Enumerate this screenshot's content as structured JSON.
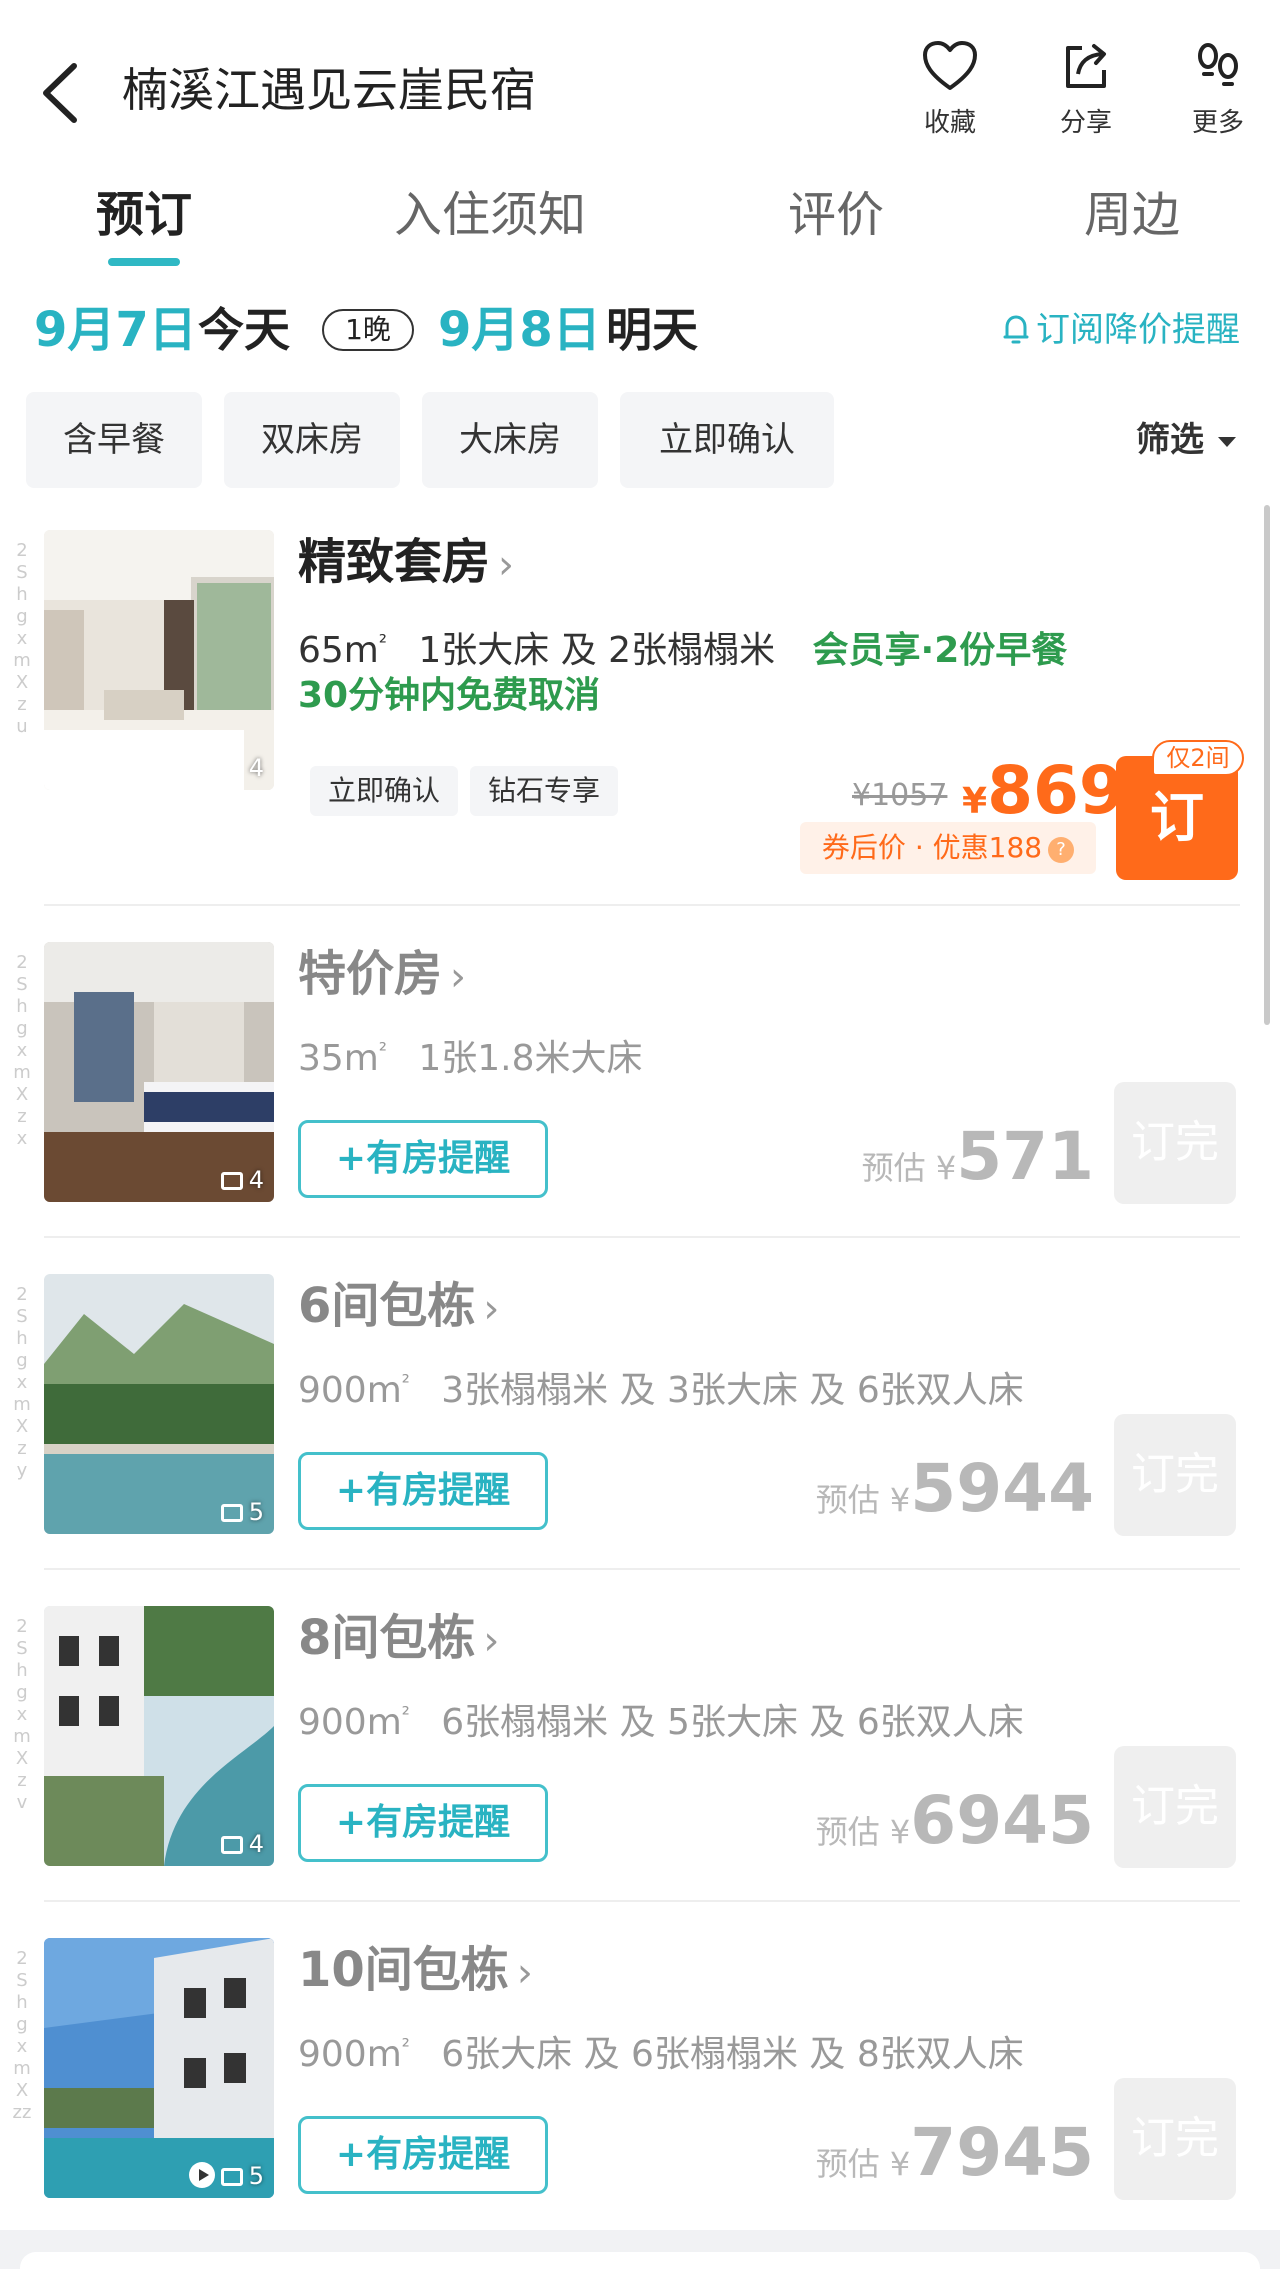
{
  "header": {
    "title": "楠溪江遇见云崖民宿",
    "actions": [
      {
        "label": "收藏",
        "icon": "heart-icon"
      },
      {
        "label": "分享",
        "icon": "share-icon"
      },
      {
        "label": "更多",
        "icon": "footprints-icon"
      }
    ]
  },
  "tabs": [
    {
      "label": "预订",
      "active": true
    },
    {
      "label": "入住须知",
      "active": false
    },
    {
      "label": "评价",
      "active": false
    },
    {
      "label": "周边",
      "active": false
    }
  ],
  "dates": {
    "checkin": "9月7日",
    "checkin_word": "今天",
    "nights": "1晚",
    "checkout": "9月8日",
    "checkout_word": "明天",
    "subscribe": "订阅降价提醒"
  },
  "filters": {
    "chips": [
      "含早餐",
      "双床房",
      "大床房",
      "立即确认"
    ],
    "sift": "筛选"
  },
  "rooms": [
    {
      "name": "精致套房",
      "area": "65m",
      "area_unit": "²",
      "beds": "1张大床 及 2张榻榻米",
      "perk": "会员享·2份早餐",
      "cancel": "30分钟内免费取消",
      "tags": [
        "立即确认",
        "钻石专享"
      ],
      "price_original": "¥1057",
      "currency": "¥",
      "price": "869",
      "coupon": "券后价 · 优惠188",
      "coupon_help": "?",
      "book_label": "订",
      "book_badge": "仅2间",
      "photos": "4",
      "side": "2ShgxmXzu"
    },
    {
      "name": "特价房",
      "area": "35m",
      "area_unit": "²",
      "beds": "1张1.8米大床",
      "notify": "+有房提醒",
      "est_label": "预估 ¥",
      "price": "571",
      "soldout_label": "订完",
      "photos": "4",
      "side": "2ShgxmXzx"
    },
    {
      "name": "6间包栋",
      "area": "900m",
      "area_unit": "²",
      "beds": "3张榻榻米 及 3张大床 及 6张双人床",
      "notify": "+有房提醒",
      "est_label": "预估 ¥",
      "price": "5944",
      "soldout_label": "订完",
      "photos": "5",
      "side": "2ShgxmXzy"
    },
    {
      "name": "8间包栋",
      "area": "900m",
      "area_unit": "²",
      "beds": "6张榻榻米 及 5张大床 及 6张双人床",
      "notify": "+有房提醒",
      "est_label": "预估 ¥",
      "price": "6945",
      "soldout_label": "订完",
      "photos": "4",
      "side": "2ShgxmXzv"
    },
    {
      "name": "10间包栋",
      "area": "900m",
      "area_unit": "²",
      "beds": "6张大床 及 6张榻榻米 及 8张双人床",
      "notify": "+有房提醒",
      "est_label": "预估 ¥",
      "price": "7945",
      "soldout_label": "订完",
      "photos": "5",
      "side": "2ShgxmXzz"
    }
  ],
  "colors": {
    "accent": "#29b3c2",
    "price": "#ff6a1a",
    "perk": "#2e9b4e"
  }
}
